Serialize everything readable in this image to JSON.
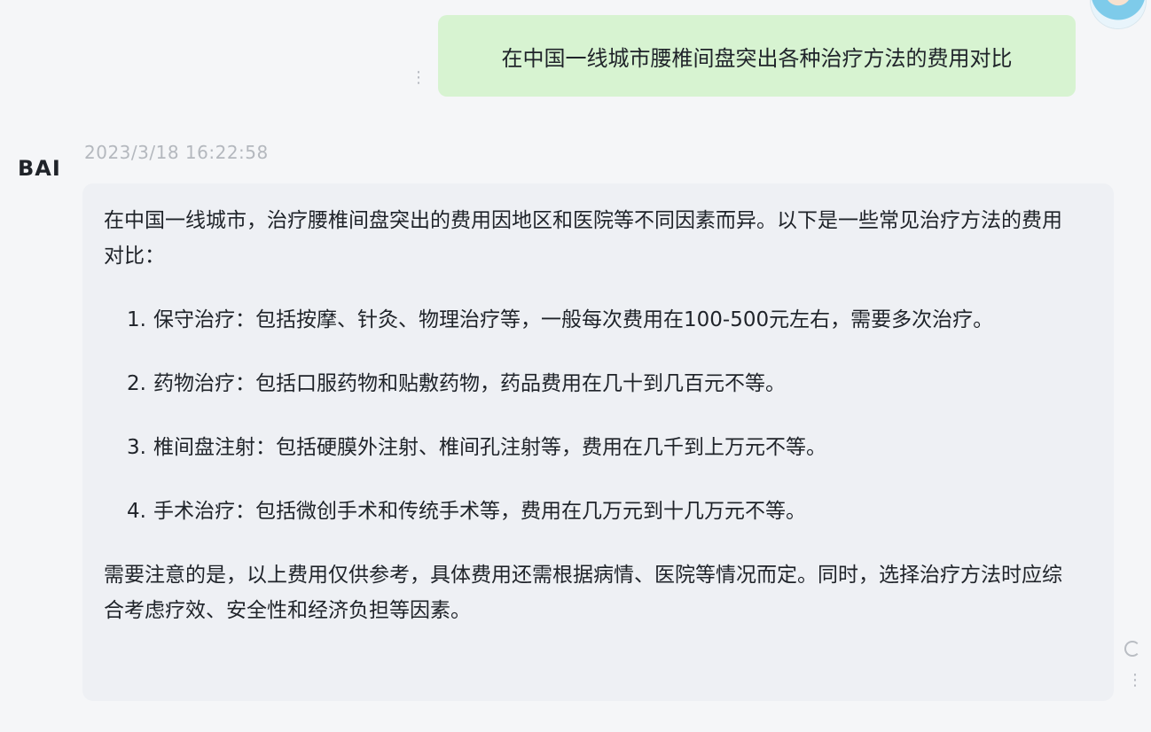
{
  "user_message": {
    "text": "在中国一线城市腰椎间盘突出各种治疗方法的费用对比",
    "more_icon": "⋮"
  },
  "bot": {
    "logo": "BAI",
    "timestamp": "2023/3/18 16:22:58",
    "intro": "在中国一线城市，治疗腰椎间盘突出的费用因地区和医院等不同因素而异。以下是一些常见治疗方法的费用对比：",
    "steps": [
      {
        "num": "1.",
        "text": "保守治疗：包括按摩、针灸、物理治疗等，一般每次费用在100-500元左右，需要多次治疗。"
      },
      {
        "num": "2.",
        "text": "药物治疗：包括口服药物和贴敷药物，药品费用在几十到几百元不等。"
      },
      {
        "num": "3.",
        "text": "椎间盘注射：包括硬膜外注射、椎间孔注射等，费用在几千到上万元不等。"
      },
      {
        "num": "4.",
        "text": "手术治疗：包括微创手术和传统手术等，费用在几万元到十几万元不等。"
      }
    ],
    "note": "需要注意的是，以上费用仅供参考，具体费用还需根据病情、医院等情况而定。同时，选择治疗方法时应综合考虑疗效、安全性和经济负担等因素。"
  },
  "controls": {
    "refresh_icon": "refresh-icon",
    "more_icon": "⋮"
  },
  "colors": {
    "user_bubble": "#d7f3d1",
    "bot_bubble": "#eef0f4",
    "background": "#f5f6f8",
    "timestamp": "#b4b8be"
  }
}
